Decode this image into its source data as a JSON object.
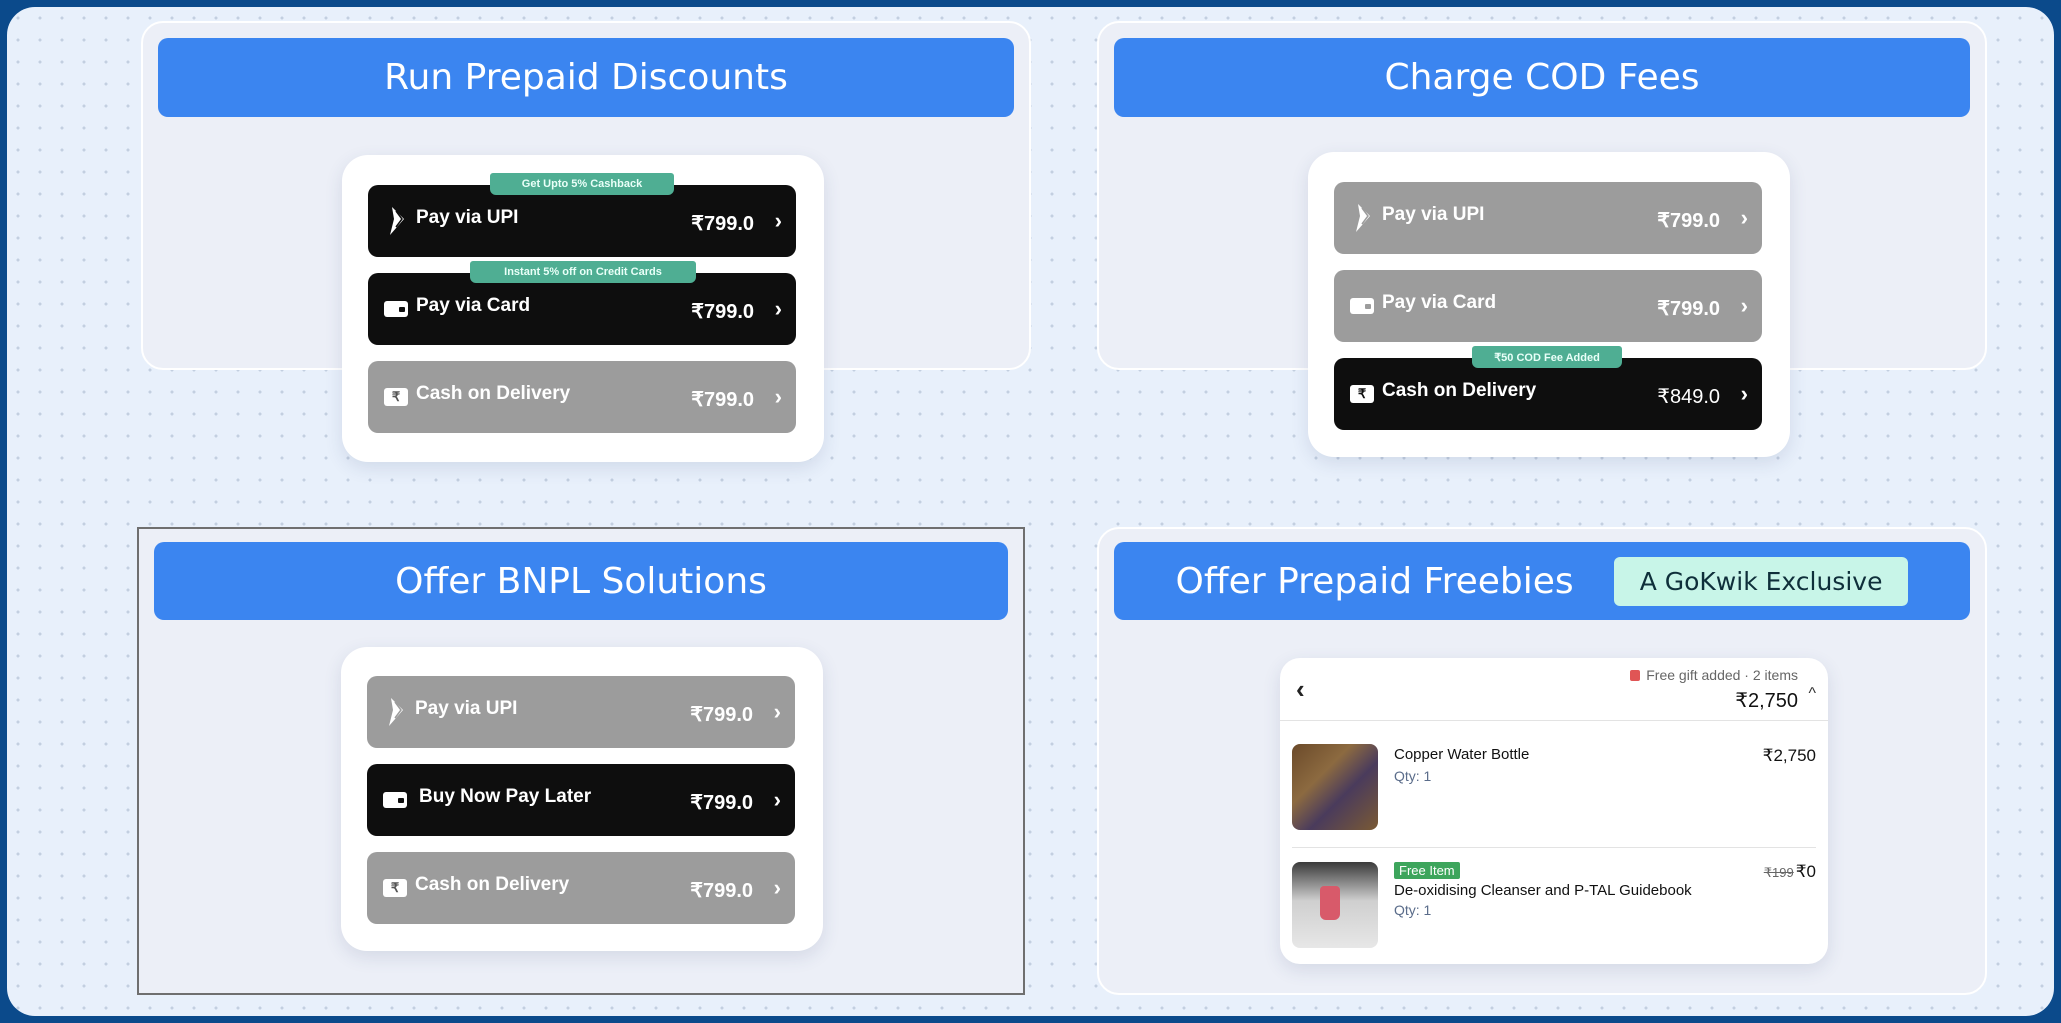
{
  "panels": {
    "prepaid_discounts": {
      "title": "Run Prepaid Discounts",
      "rows": [
        {
          "label": "Pay via UPI",
          "price": "₹799.0",
          "tag": "Get Upto 5% Cashback"
        },
        {
          "label": "Pay via Card",
          "price": "₹799.0",
          "tag": "Instant 5% off on Credit Cards"
        },
        {
          "label": "Cash on Delivery",
          "price": "₹799.0",
          "icon_text": "₹"
        }
      ]
    },
    "cod_fees": {
      "title": "Charge COD Fees",
      "rows": [
        {
          "label": "Pay via UPI",
          "price": "₹799.0"
        },
        {
          "label": "Pay via Card",
          "price": "₹799.0"
        },
        {
          "label": "Cash on Delivery",
          "price": "₹849.0",
          "tag": "₹50 COD Fee Added",
          "icon_text": "₹"
        }
      ]
    },
    "bnpl": {
      "title": "Offer BNPL Solutions",
      "rows": [
        {
          "label": "Pay via UPI",
          "price": "₹799.0"
        },
        {
          "label": "Buy Now Pay Later",
          "price": "₹799.0"
        },
        {
          "label": "Cash on Delivery",
          "price": "₹799.0",
          "icon_text": "₹"
        }
      ]
    },
    "freebies": {
      "title": "Offer Prepaid Freebies",
      "badge": "A GoKwik Exclusive",
      "cart": {
        "back": "‹",
        "gift_line": "Free gift added · 2 items",
        "total": "₹2,750",
        "caret": "^",
        "items": [
          {
            "name": "Copper Water Bottle",
            "qty": "Qty: 1",
            "price": "₹2,750"
          },
          {
            "badge": "Free Item",
            "name": "De-oxidising Cleanser and P-TAL Guidebook",
            "qty": "Qty: 1",
            "old_price": "₹199",
            "price": "₹0"
          }
        ]
      }
    }
  },
  "chevron": "›",
  "colors": {
    "header_blue": "#3b85f0",
    "row_dark": "#0e0e0e",
    "row_gray": "#9c9c9c",
    "tag_green": "#4fae93",
    "badge_mint": "#c8f5e8",
    "frame_border": "#0b4a8b"
  }
}
